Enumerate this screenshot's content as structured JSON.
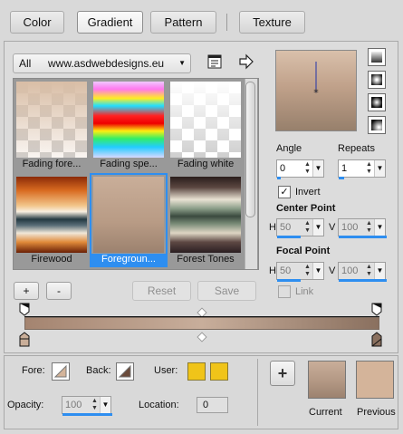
{
  "tabs": [
    {
      "label": "Color"
    },
    {
      "label": "Gradient"
    },
    {
      "label": "Pattern"
    },
    {
      "label": "Texture"
    }
  ],
  "library": {
    "category": "All",
    "source": "www.asdwebdesigns.eu"
  },
  "gradients": [
    {
      "name": "Fading fore..."
    },
    {
      "name": "Fading spe..."
    },
    {
      "name": "Fading white"
    },
    {
      "name": "Firewood"
    },
    {
      "name": "Foregroun..."
    },
    {
      "name": "Forest Tones"
    }
  ],
  "buttons": {
    "add": "+",
    "remove": "-",
    "reset": "Reset",
    "save": "Save"
  },
  "settings": {
    "angle_label": "Angle",
    "angle_value": "0",
    "repeats_label": "Repeats",
    "repeats_value": "1",
    "invert_label": "Invert",
    "invert_checked": true,
    "center_point_label": "Center Point",
    "center_h_label": "H",
    "center_h": "50",
    "center_v_label": "V",
    "center_v": "100",
    "focal_point_label": "Focal Point",
    "focal_h_label": "H",
    "focal_h": "50",
    "focal_v_label": "V",
    "focal_v": "100",
    "link_label": "Link",
    "link_checked": false
  },
  "bottom": {
    "fore_label": "Fore:",
    "back_label": "Back:",
    "user_label": "User:",
    "opacity_label": "Opacity:",
    "opacity_value": "100",
    "location_label": "Location:",
    "location_value": "0",
    "current_label": "Current",
    "previous_label": "Previous"
  },
  "colors": {
    "accent": "#2e8ef0",
    "user_swatch": "#f0c419",
    "current": "#b59a86",
    "previous": "#d4b49a"
  },
  "icons": [
    "library-menu-icon",
    "arrow-right-icon",
    "style-linear-icon",
    "style-radial-icon",
    "style-rectangular-icon",
    "style-sunburst-icon",
    "add-icon",
    "stop-marker-icon",
    "midpoint-marker-icon"
  ]
}
